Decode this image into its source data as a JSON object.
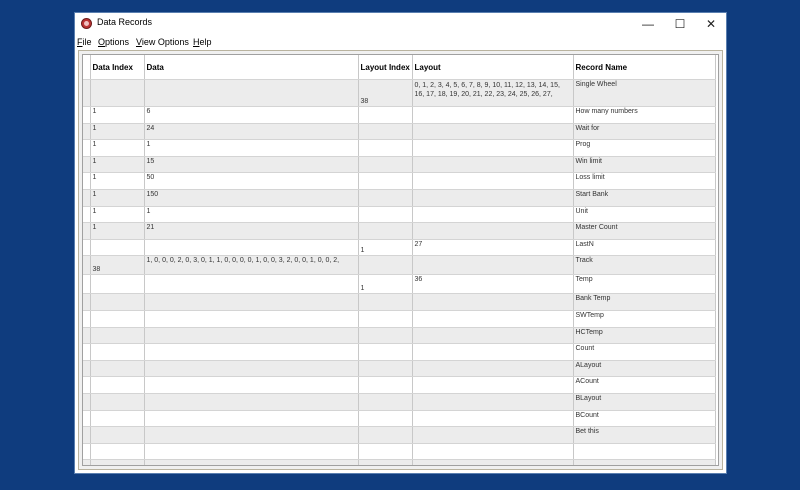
{
  "window": {
    "title": "Data Records"
  },
  "titlebar_buttons": {
    "minimize": "—",
    "maximize": "☐",
    "close": "✕"
  },
  "menu": [
    {
      "label": "File"
    },
    {
      "label": "Options"
    },
    {
      "label": "View Options"
    },
    {
      "label": "Help"
    }
  ],
  "columns": [
    "Data Index",
    "Data",
    "Layout Index",
    "Layout",
    "Record Name"
  ],
  "rows": [
    {
      "data_index": "",
      "data": "",
      "layout_index": "38",
      "layout": "0, 1, 2, 3, 4, 5, 6, 7, 8, 9, 10, 11, 12, 13, 14, 15, 16, 17, 18, 19, 20, 21, 22, 23, 24, 25, 26, 27,",
      "record_name": "Single Wheel"
    },
    {
      "data_index": "1",
      "data": "6",
      "layout_index": "",
      "layout": "",
      "record_name": "How many numbers"
    },
    {
      "data_index": "1",
      "data": "24",
      "layout_index": "",
      "layout": "",
      "record_name": "Wait for"
    },
    {
      "data_index": "1",
      "data": "1",
      "layout_index": "",
      "layout": "",
      "record_name": "Prog"
    },
    {
      "data_index": "1",
      "data": "15",
      "layout_index": "",
      "layout": "",
      "record_name": "Win limit"
    },
    {
      "data_index": "1",
      "data": "50",
      "layout_index": "",
      "layout": "",
      "record_name": "Loss limit"
    },
    {
      "data_index": "1",
      "data": "150",
      "layout_index": "",
      "layout": "",
      "record_name": "Start Bank"
    },
    {
      "data_index": "1",
      "data": "1",
      "layout_index": "",
      "layout": "",
      "record_name": "Unit"
    },
    {
      "data_index": "1",
      "data": "21",
      "layout_index": "",
      "layout": "",
      "record_name": "Master Count"
    },
    {
      "data_index": "",
      "data": "",
      "layout_index": "1",
      "layout": "27",
      "record_name": "LastN"
    },
    {
      "data_index": "38",
      "data": "1, 0, 0, 0, 2, 0, 3, 0, 1, 1, 0, 0, 0, 0, 1, 0, 0, 3, 2, 0, 0, 1, 0, 0, 2,",
      "layout_index": "",
      "layout": "",
      "record_name": "Track"
    },
    {
      "data_index": "",
      "data": "",
      "layout_index": "1",
      "layout": "36",
      "record_name": "Temp"
    },
    {
      "data_index": "",
      "data": "",
      "layout_index": "",
      "layout": "",
      "record_name": "Bank Temp"
    },
    {
      "data_index": "",
      "data": "",
      "layout_index": "",
      "layout": "",
      "record_name": "SWTemp"
    },
    {
      "data_index": "",
      "data": "",
      "layout_index": "",
      "layout": "",
      "record_name": "HCTemp"
    },
    {
      "data_index": "",
      "data": "",
      "layout_index": "",
      "layout": "",
      "record_name": "Count"
    },
    {
      "data_index": "",
      "data": "",
      "layout_index": "",
      "layout": "",
      "record_name": "ALayout"
    },
    {
      "data_index": "",
      "data": "",
      "layout_index": "",
      "layout": "",
      "record_name": "ACount"
    },
    {
      "data_index": "",
      "data": "",
      "layout_index": "",
      "layout": "",
      "record_name": "BLayout"
    },
    {
      "data_index": "",
      "data": "",
      "layout_index": "",
      "layout": "",
      "record_name": "BCount"
    },
    {
      "data_index": "",
      "data": "",
      "layout_index": "",
      "layout": "",
      "record_name": "Bet this"
    },
    {
      "data_index": "",
      "data": "",
      "layout_index": "",
      "layout": "",
      "record_name": ""
    },
    {
      "data_index": "",
      "data": "",
      "layout_index": "",
      "layout": "",
      "record_name": ""
    },
    {
      "data_index": "",
      "data": "",
      "layout_index": "",
      "layout": "",
      "record_name": ""
    }
  ],
  "colors": {
    "desktop": "#0f3c7e",
    "alt_row": "#ececec"
  }
}
